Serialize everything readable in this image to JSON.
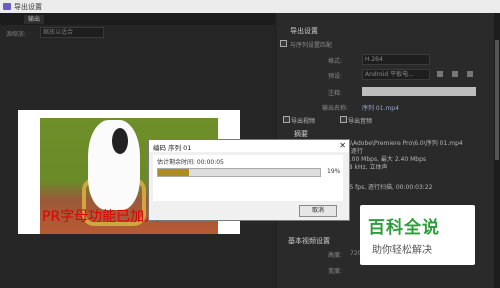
{
  "window": {
    "title": "导出设置"
  },
  "left": {
    "tab_label": "输出",
    "source_label": "源缩放:",
    "source_value": "缩放以适合"
  },
  "preview": {
    "overlay_text": "PR字母功能已加入"
  },
  "export_settings": {
    "section_title": "导出设置",
    "match_sequence": "与序列设置匹配",
    "format_label": "格式:",
    "format_value": "H.264",
    "preset_label": "预设:",
    "preset_value": "Android 平板电...",
    "comments_label": "注释:",
    "output_name_label": "输出名称:",
    "output_name_value": "序列 01.mp4",
    "export_video": "导出视频",
    "export_audio": "导出音频"
  },
  "summary": {
    "title": "摘要",
    "lines": [
      "ents\\Adobe\\Premiere Pro\\6.0\\序列 01.mp4",
      "fps, 逐行",
      "标 2.00 Mbps, 最大 2.40 Mbps",
      "z, 48 kHz, 立体声",
      "01",
      "5, 25 fps, 逐行扫描, 00:00:03:22",
      "体声"
    ]
  },
  "basic_video": {
    "title": "基本视频设置",
    "height_label": "高度:",
    "height_value": "720",
    "width_label": "宽度:"
  },
  "dialog": {
    "title": "编码 序列 01",
    "estimate": "估计剩余时间: 00:00:05",
    "progress_pct": "19%",
    "progress": 0.19,
    "cancel_label": "取消"
  },
  "watermark": {
    "line1": "百科全说",
    "line2": "助你轻松解决"
  },
  "colors": {
    "progress": "#ad8d22",
    "watermark": "#2e9e3a",
    "overlay": "#e00000"
  }
}
